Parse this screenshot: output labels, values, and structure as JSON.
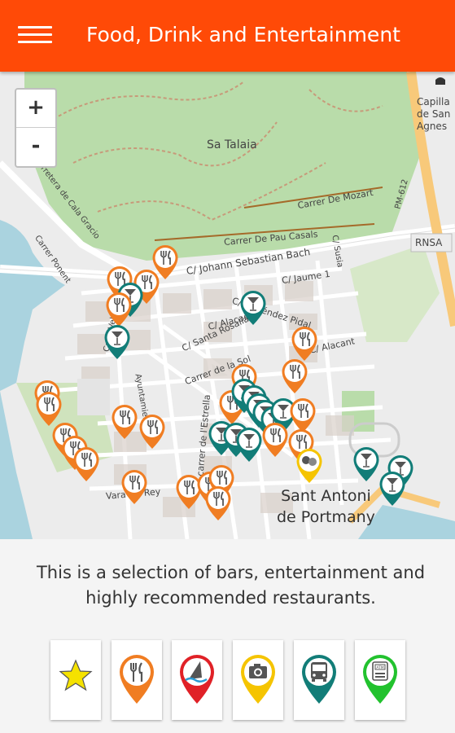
{
  "app_bar": {
    "title": "Food, Drink and Entertainment",
    "color": "#ff4a07"
  },
  "map": {
    "zoom_in_label": "+",
    "zoom_out_label": "-",
    "labels": {
      "park": "Sa Talaia",
      "church": "Capilla de San Agnes",
      "rnsa": "RNSA",
      "pm612": "PM-612",
      "mozart": "Carrer De Mozart",
      "pau_casals": "Carrer De Pau Casals",
      "bach": "C/ Johann Sebastian Bach",
      "jaume": "C/ Jaume 1",
      "menendez": "C/ Menéndez Pidal",
      "alacant": "C/ Alacant",
      "alacant2": "C/ Alacant",
      "santa_rosalia": "C/ Santa Rosalía",
      "sol": "Carrer de la Sol",
      "estrella": "carrer de l'Estrella",
      "velazquez": "Calle Velázquez",
      "cala_gracio": "Carretera de Cala Gracio",
      "ponent": "Carrer Ponent",
      "vara_de_rey": "Vara De Rey",
      "town": "Sant Antoni de Portmany",
      "town_line1": "Sant Antoni",
      "town_line2": "de Portmany",
      "susia": "C/ Susia",
      "ayuntamiento": "Ayuntamiento"
    },
    "markers": {
      "restaurant_color": "#f07d22",
      "bar_color": "#127d78",
      "entertainment_color": "#f5c400",
      "restaurant_icon": "cutlery-icon",
      "bar_icon": "cocktail-icon",
      "entertainment_icon": "theater-masks-icon"
    }
  },
  "description": "This is a selection of bars, entertainment and highly recommended restaurants.",
  "categories": [
    {
      "name": "favorites",
      "icon": "star-icon",
      "color": "#f5e200"
    },
    {
      "name": "food-drink",
      "icon": "cutlery-icon",
      "color": "#f07d22"
    },
    {
      "name": "beaches-water-sports",
      "icon": "windsurf-icon",
      "color": "#e02127"
    },
    {
      "name": "sightseeing",
      "icon": "camera-icon",
      "color": "#f5c400"
    },
    {
      "name": "transport",
      "icon": "bus-icon",
      "color": "#127d78"
    },
    {
      "name": "atm",
      "icon": "atm-icon",
      "color": "#22c22e"
    }
  ]
}
